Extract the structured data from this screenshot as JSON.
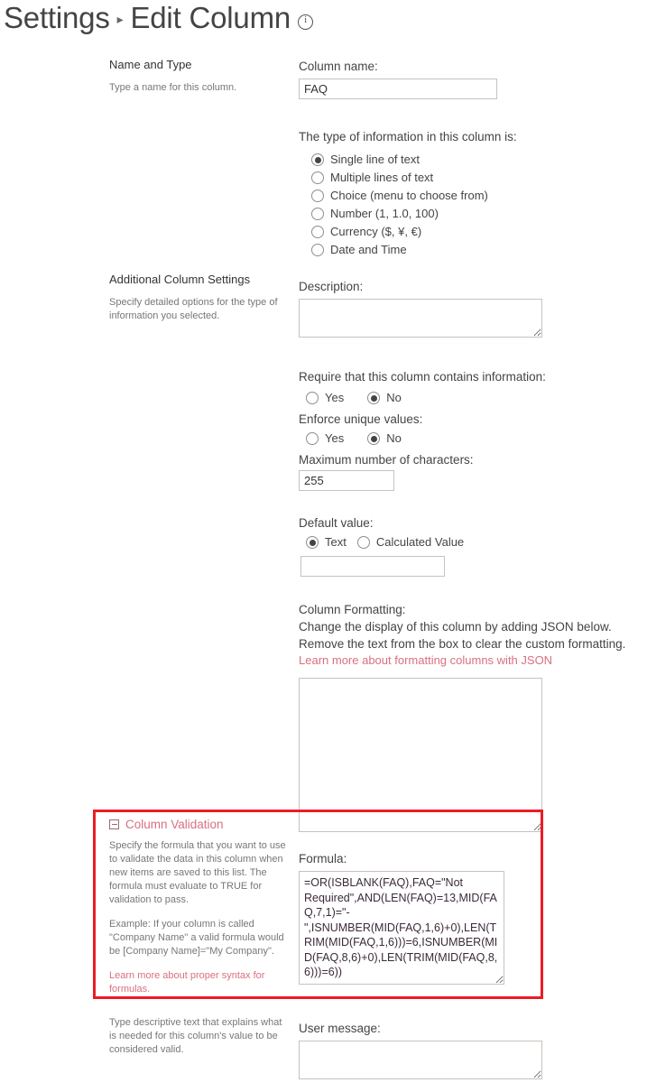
{
  "header": {
    "breadcrumb_root": "Settings",
    "separator": "▸",
    "title": "Edit Column",
    "info_icon": "info-icon"
  },
  "name_and_type": {
    "section_title": "Name and Type",
    "helper": "Type a name for this column.",
    "column_name_label": "Column name:",
    "column_name_value": "FAQ",
    "type_question": "The type of information in this column is:",
    "type_options": [
      {
        "label": "Single line of text",
        "selected": true
      },
      {
        "label": "Multiple lines of text",
        "selected": false
      },
      {
        "label": "Choice (menu to choose from)",
        "selected": false
      },
      {
        "label": "Number (1, 1.0, 100)",
        "selected": false
      },
      {
        "label": "Currency ($, ¥, €)",
        "selected": false
      },
      {
        "label": "Date and Time",
        "selected": false
      }
    ]
  },
  "additional_settings": {
    "section_title": "Additional Column Settings",
    "helper": "Specify detailed options for the type of information you selected.",
    "description_label": "Description:",
    "description_value": "",
    "require_label": "Require that this column contains information:",
    "require_yes": "Yes",
    "require_no": "No",
    "require_selected": "No",
    "unique_label": "Enforce unique values:",
    "unique_yes": "Yes",
    "unique_no": "No",
    "unique_selected": "No",
    "max_chars_label": "Maximum number of characters:",
    "max_chars_value": "255",
    "default_value_label": "Default value:",
    "default_text_option": "Text",
    "default_calculated_option": "Calculated Value",
    "default_selected": "Text",
    "default_value": "",
    "formatting_label": "Column Formatting:",
    "formatting_line1": "Change the display of this column by adding JSON below.",
    "formatting_line2": "Remove the text from the box to clear the custom formatting.",
    "formatting_link": "Learn more about formatting columns with JSON",
    "formatting_value": ""
  },
  "column_validation": {
    "collapse_icon": "collapse-icon",
    "title": "Column Validation",
    "description": "Specify the formula that you want to use to validate the data in this column when new items are saved to this list. The formula must evaluate to TRUE for validation to pass.",
    "example": "Example: If your column is called \"Company Name\" a valid formula would be [Company Name]=\"My Company\".",
    "syntax_link": "Learn more about proper syntax for formulas.",
    "formula_label": "Formula:",
    "formula_value": "=OR(ISBLANK(FAQ),FAQ=\"Not Required\",AND(LEN(FAQ)=13,MID(FAQ,7,1)=\"-\",ISNUMBER(MID(FAQ,1,6)+0),LEN(TRIM(MID(FAQ,1,6)))=6,ISNUMBER(MID(FAQ,8,6)+0),LEN(TRIM(MID(FAQ,8,6)))=6))"
  },
  "user_message": {
    "helper": "Type descriptive text that explains what is needed for this column's value to be considered valid.",
    "label": "User message:",
    "value": ""
  },
  "colors": {
    "link": "#d9707f",
    "annotation": "#ec1c24",
    "border": "#c8c2bc",
    "text": "#444444",
    "muted": "#777777"
  }
}
